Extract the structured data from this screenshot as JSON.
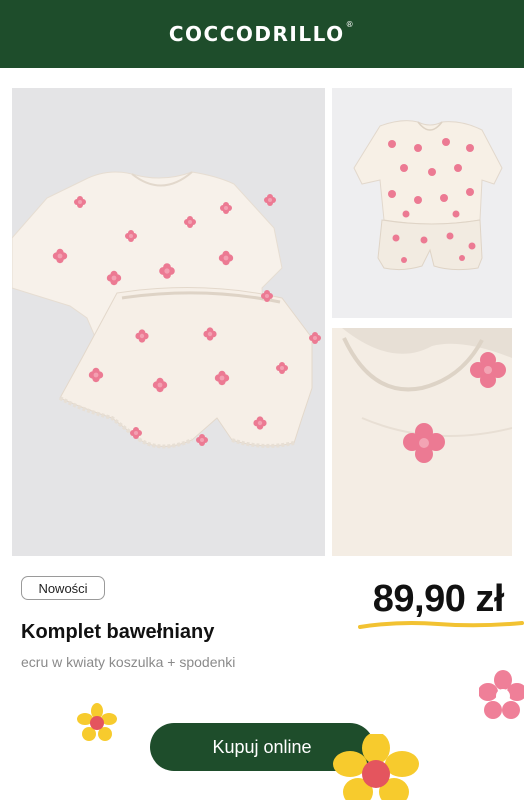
{
  "header": {
    "brand": "COCCODRILLO",
    "trademark": "®",
    "background": "#1e4d2b"
  },
  "gallery": {
    "images": [
      {
        "alt": "pink flower pajama set flat lay"
      },
      {
        "alt": "set on hanger"
      },
      {
        "alt": "collar detail"
      }
    ]
  },
  "product": {
    "badge": "Nowości",
    "title": "Komplet bawełniany",
    "subtitle": "ecru w kwiaty koszulka + spodenki",
    "price": "89,90 zł"
  },
  "cta": {
    "label": "Kupuj online"
  },
  "colors": {
    "accent_green": "#1e4d2b",
    "flower_pink": "#ec7a93",
    "flower_yellow": "#f7cb2d",
    "underline_yellow": "#f2c232"
  },
  "icons": [
    "yellow-flower-icon",
    "pink-flower-icon",
    "big-yellow-flower-icon"
  ]
}
